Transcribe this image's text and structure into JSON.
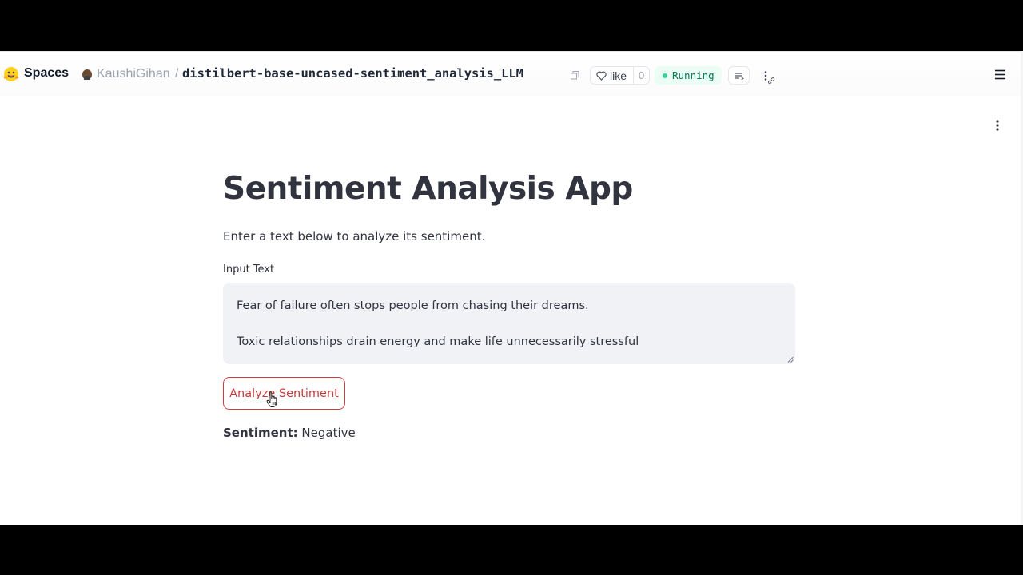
{
  "header": {
    "brand": "Spaces",
    "owner": "KaushiGihan",
    "separator": "/",
    "repo": "distilbert-base-uncased-sentiment_analysis_LLM",
    "like_label": "like",
    "like_count": "0",
    "status": "Running",
    "status_color": "#047857"
  },
  "app": {
    "title": "Sentiment Analysis App",
    "subtitle": "Enter a text below to analyze its sentiment.",
    "input_label": "Input Text",
    "input_value": "Fear of failure often stops people from chasing their dreams.\n\nToxic relationships drain energy and make life unnecessarily stressful",
    "button_label": "Analyze Sentiment",
    "button_color": "#d33c3c",
    "result_label": "Sentiment:",
    "result_value": "Negative"
  },
  "icons": {
    "logo": "hugging-face-icon",
    "copy": "copy-icon",
    "like": "heart-icon",
    "logs": "logs-icon",
    "more": "more-vertical-icon",
    "menu": "hamburger-icon",
    "app_menu": "more-vertical-icon"
  }
}
